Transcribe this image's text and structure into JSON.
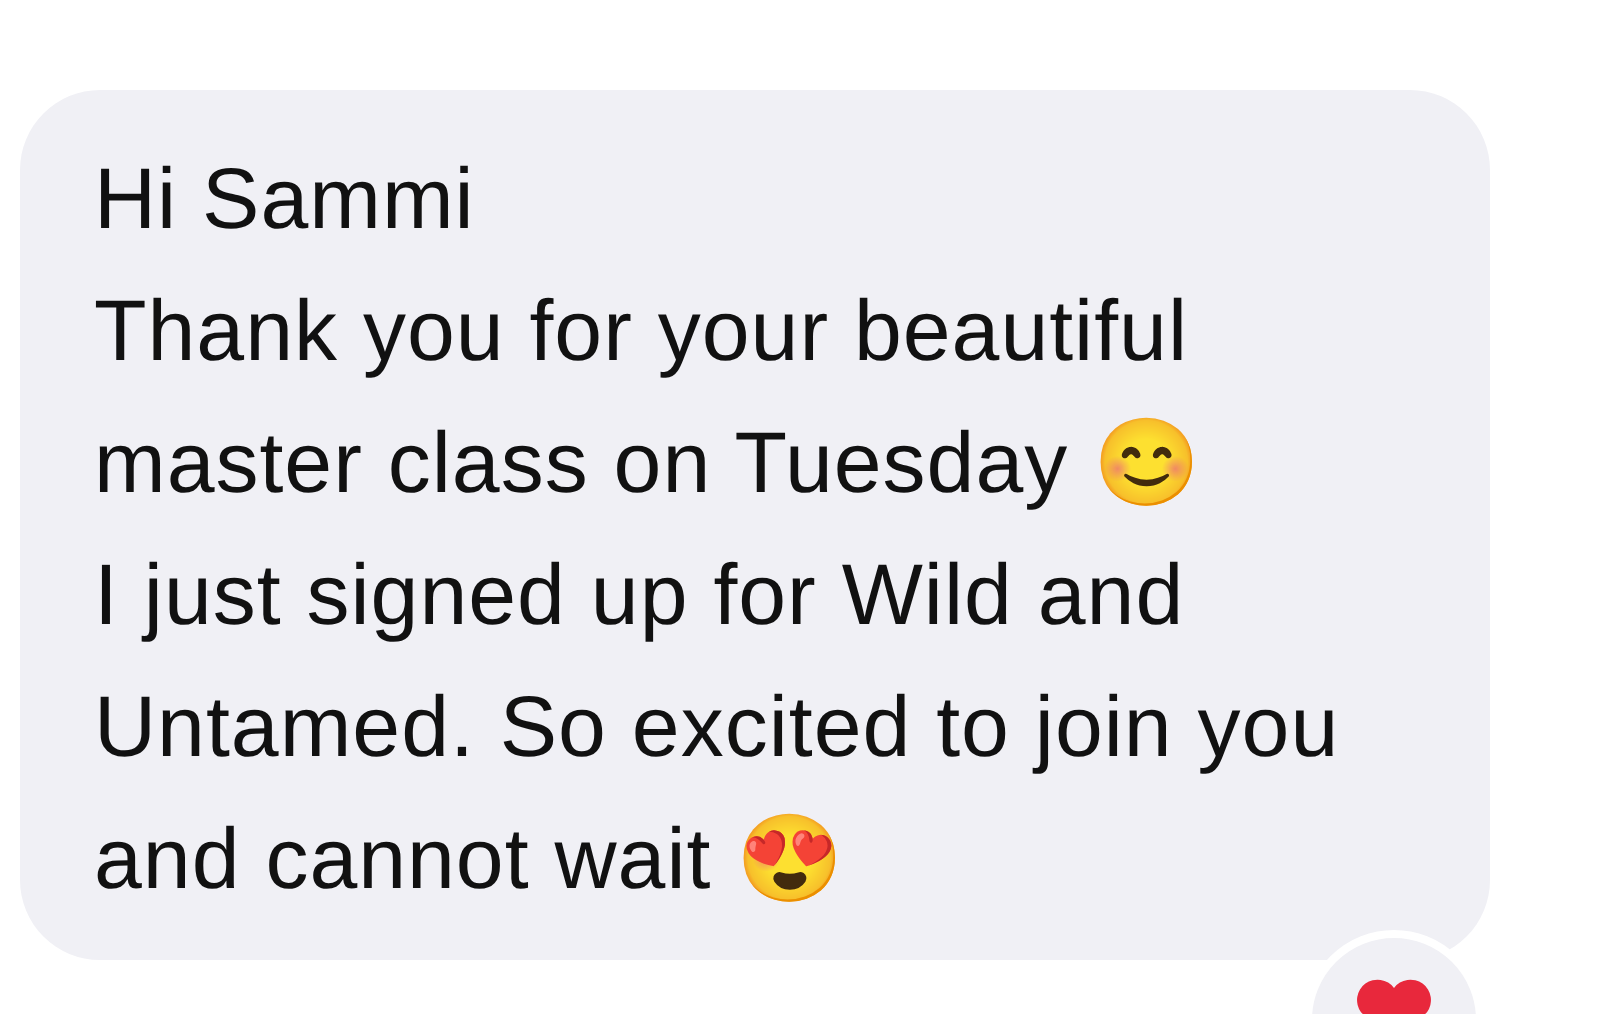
{
  "message": {
    "paragraphs": [
      {
        "text": "Hi Sammi"
      },
      {
        "text": "Thank you for your beautiful master class on Tuesday",
        "emoji": "😊"
      },
      {
        "text": "I just signed up for Wild and Untamed. So excited to join you and cannot wait",
        "emoji": "😍"
      }
    ],
    "reaction": {
      "kind": "heart"
    }
  }
}
